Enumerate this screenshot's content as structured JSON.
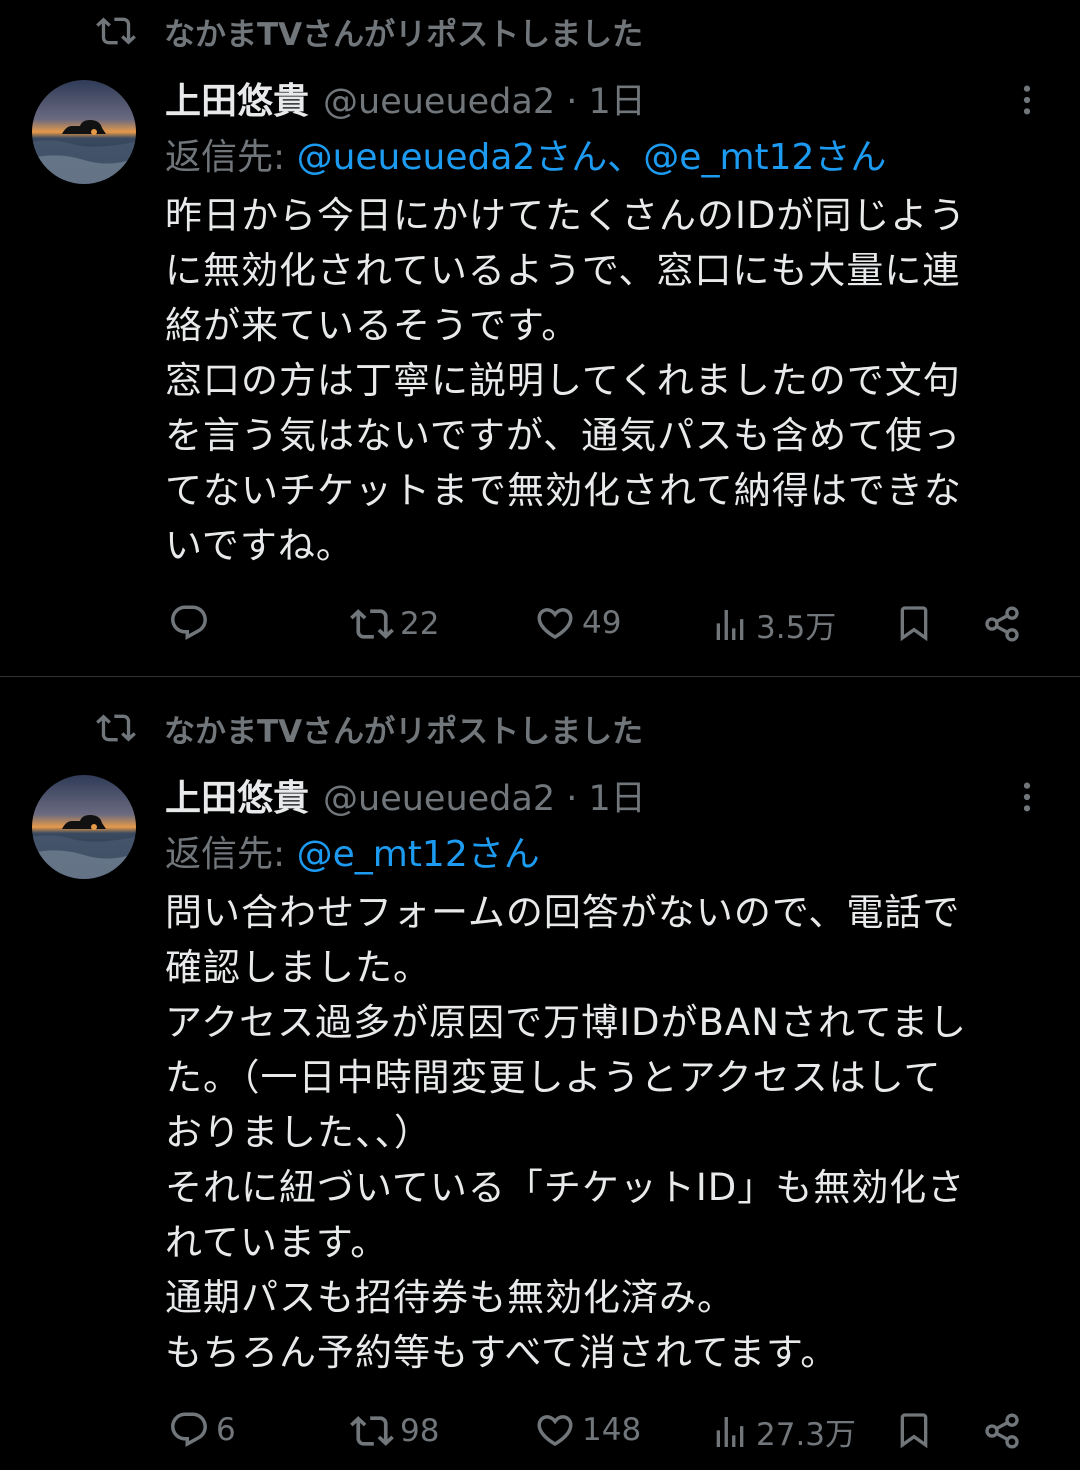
{
  "posts": [
    {
      "repost_label": "なかまTVさんがリポストしました",
      "author_name": "上田悠貴",
      "author_handle_time": "@ueueueda2 · 1日",
      "reply_prefix": "返信先: ",
      "reply_mentions": "@ueueueda2さん、@e_mt12さん",
      "body_lines": [
        "昨日から今日にかけてたくさんのIDが同じよう",
        "に無効化されているようで、窓口にも大量に連",
        "絡が来ているそうです。",
        "窓口の方は丁寧に説明してくれましたので文句",
        "を言う気はないですが、通気パスも含めて使っ",
        "てないチケットまで無効化されて納得はできな",
        "いですね。"
      ],
      "replies": "",
      "reposts": "22",
      "likes": "49",
      "views": "3.5万"
    },
    {
      "repost_label": "なかまTVさんがリポストしました",
      "author_name": "上田悠貴",
      "author_handle_time": "@ueueueda2 · 1日",
      "reply_prefix": "返信先: ",
      "reply_mentions": "@e_mt12さん",
      "body_lines": [
        "問い合わせフォームの回答がないので、電話で",
        "確認しました。",
        "アクセス過多が原因で万博IDがBANされてまし",
        "た。（一日中時間変更しようとアクセスはして",
        "おりました、、）",
        "それに紐づいている「チケットID」も無効化さ",
        "れています。",
        "通期パスも招待券も無効化済み。",
        "もちろん予約等もすべて消されてます。"
      ],
      "replies": "6",
      "reposts": "98",
      "likes": "148",
      "views": "27.3万"
    }
  ],
  "colors": {
    "background": "#000000",
    "text": "#e7e9ea",
    "muted": "#71767b",
    "mention": "#1d9bf0",
    "divider": "#2f3336"
  },
  "icons": [
    "repost-icon",
    "more-icon",
    "reply-icon",
    "like-icon",
    "views-icon",
    "bookmark-icon",
    "share-icon"
  ]
}
